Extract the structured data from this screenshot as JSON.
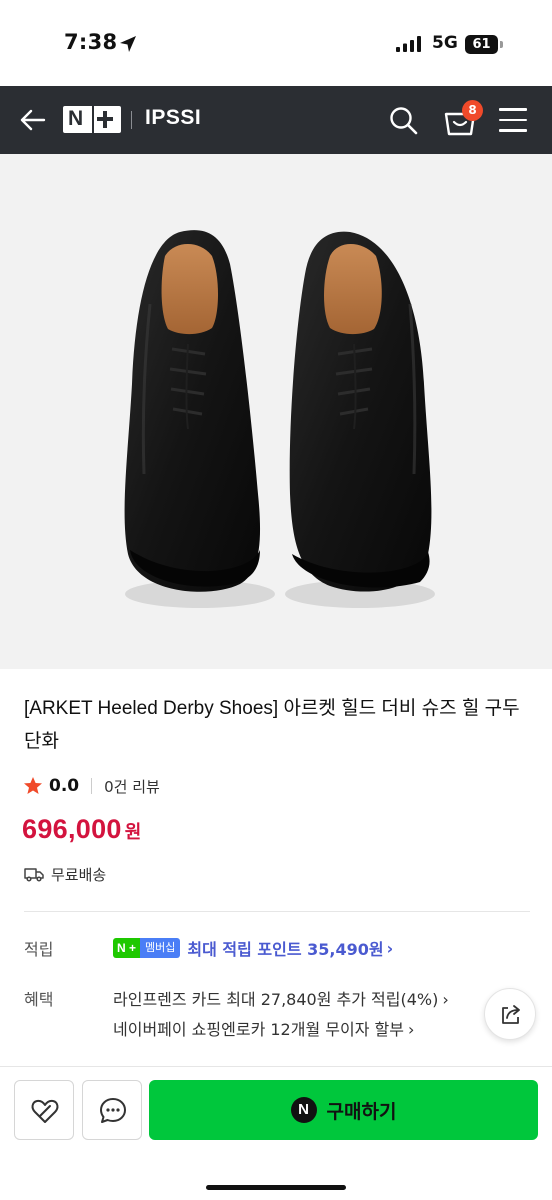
{
  "status_bar": {
    "time": "7:38",
    "network": "5G",
    "battery": "61",
    "icons": [
      "location-arrow-icon",
      "signal-bars-icon",
      "battery-icon"
    ]
  },
  "header": {
    "logo": "N+",
    "store_name": "IPSSI",
    "cart_count": "8",
    "background": "#2b2e33",
    "icons": [
      "back-arrow-icon",
      "search-icon",
      "cart-icon",
      "hamburger-menu-icon"
    ]
  },
  "product": {
    "title": "[ARKET Heeled Derby Shoes] 아르켓 힐드 더비 슈즈 힐 구두 단화",
    "rating": "0.0",
    "review_count": "0건 리뷰",
    "price": "696,000",
    "price_unit": "원",
    "price_color": "#d3133e",
    "shipping": "무료배송"
  },
  "points": {
    "label": "적립",
    "badge_n": "N",
    "badge_plus": "+",
    "badge_text": "멤버십",
    "text": "최대 적립 포인트 35,490원",
    "chevron": "›"
  },
  "benefits": {
    "label": "혜택",
    "items": [
      "라인프렌즈 카드 최대 27,840원 추가 적립(4%)",
      "네이버페이 쇼핑엔로카 12개월 무이자 할부"
    ],
    "chevron": "›"
  },
  "bottom_bar": {
    "buy_label": "구매하기",
    "npay_letter": "N",
    "buy_color": "#00c73c",
    "icons": [
      "wishlist-heart-icon",
      "chat-bubble-icon",
      "share-icon"
    ]
  }
}
